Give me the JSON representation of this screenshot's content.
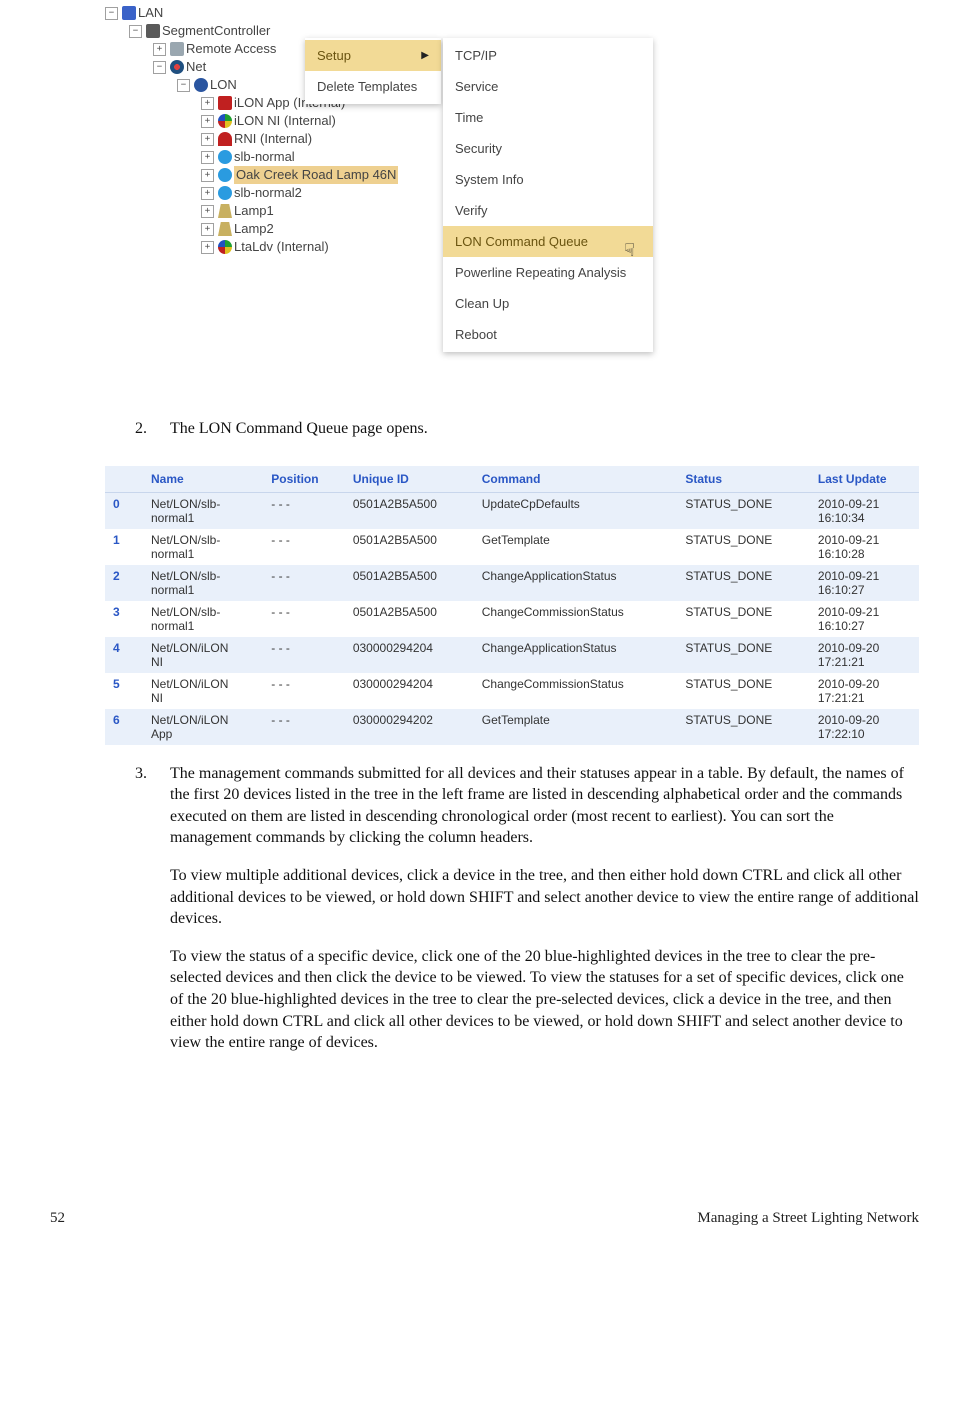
{
  "footer": {
    "page_num": "52",
    "section": "Managing a Street Lighting Network"
  },
  "tree": {
    "lan": "LAN",
    "segctl": "SegmentController",
    "remote": "Remote Access",
    "net": "Net",
    "lon": "LON",
    "items": [
      "iLON App (Internal)",
      "iLON NI (Internal)",
      "RNI (Internal)",
      "slb-normal",
      "Oak Creek Road Lamp 46N",
      "slb-normal2",
      "Lamp1",
      "Lamp2",
      "LtaLdv (Internal)"
    ]
  },
  "context_menu": {
    "setup": "Setup",
    "delete": "Delete Templates"
  },
  "submenu": {
    "items": [
      "TCP/IP",
      "Service",
      "Time",
      "Security",
      "System Info",
      "Verify",
      "LON Command Queue",
      "Powerline Repeating Analysis",
      "Clean Up",
      "Reboot"
    ],
    "highlight_index": 6
  },
  "step2": {
    "num": "2.",
    "text": "The LON Command Queue page opens."
  },
  "queue": {
    "headers": {
      "name": "Name",
      "position": "Position",
      "uid": "Unique ID",
      "command": "Command",
      "status": "Status",
      "last": "Last Update"
    },
    "rows": [
      {
        "i": "0",
        "name": "Net/LON/slb-normal1",
        "pos": "- - -",
        "uid": "0501A2B5A500",
        "cmd": "UpdateCpDefaults",
        "status": "STATUS_DONE",
        "ts": "2010-09-21 16:10:34"
      },
      {
        "i": "1",
        "name": "Net/LON/slb-normal1",
        "pos": "- - -",
        "uid": "0501A2B5A500",
        "cmd": "GetTemplate",
        "status": "STATUS_DONE",
        "ts": "2010-09-21 16:10:28"
      },
      {
        "i": "2",
        "name": "Net/LON/slb-normal1",
        "pos": "- - -",
        "uid": "0501A2B5A500",
        "cmd": "ChangeApplicationStatus",
        "status": "STATUS_DONE",
        "ts": "2010-09-21 16:10:27"
      },
      {
        "i": "3",
        "name": "Net/LON/slb-normal1",
        "pos": "- - -",
        "uid": "0501A2B5A500",
        "cmd": "ChangeCommissionStatus",
        "status": "STATUS_DONE",
        "ts": "2010-09-21 16:10:27"
      },
      {
        "i": "4",
        "name": "Net/LON/iLON NI",
        "pos": "- - -",
        "uid": "030000294204",
        "cmd": "ChangeApplicationStatus",
        "status": "STATUS_DONE",
        "ts": "2010-09-20 17:21:21"
      },
      {
        "i": "5",
        "name": "Net/LON/iLON NI",
        "pos": "- - -",
        "uid": "030000294204",
        "cmd": "ChangeCommissionStatus",
        "status": "STATUS_DONE",
        "ts": "2010-09-20 17:21:21"
      },
      {
        "i": "6",
        "name": "Net/LON/iLON App",
        "pos": "- - -",
        "uid": "030000294202",
        "cmd": "GetTemplate",
        "status": "STATUS_DONE",
        "ts": "2010-09-20 17:22:10"
      }
    ]
  },
  "step3": {
    "num": "3.",
    "p1": "The management commands submitted for all devices and their statuses appear in a table.  By default, the names of the first 20 devices listed in the tree in the left frame are listed in descending alphabetical order and the commands executed on them are listed in descending chronological order (most recent to earliest).  You can sort the management commands by clicking the column headers.",
    "p2": "To view multiple additional devices, click a device in the tree, and then either hold down CTRL and click all other additional devices to be viewed, or hold down SHIFT and select another device to view the entire range of additional devices.",
    "p3": "To view the status of a specific device, click one of the 20 blue-highlighted devices in the tree to clear the pre-selected devices and then click the device to be viewed.  To view the statuses for a set of specific devices, click one of the 20 blue-highlighted devices in the tree to clear the pre-selected devices, click a device in the tree, and then either hold down CTRL and click all other devices to be viewed, or hold down SHIFT and select another device to view the entire range of devices."
  }
}
